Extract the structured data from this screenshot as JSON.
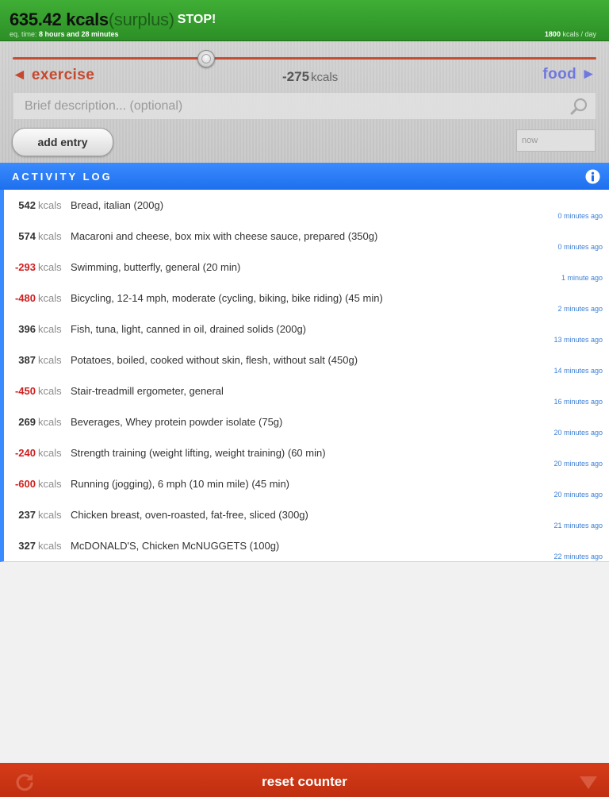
{
  "header": {
    "value": "635.42 kcals",
    "status_word": "(surplus)",
    "alert": "STOP!",
    "eq_time_label": "eq. time:",
    "eq_time_value": "8 hours and 28 minutes",
    "daily_value": "1800",
    "daily_unit": "kcals / day"
  },
  "entry": {
    "slider_level_percent": 33,
    "exercise_label": "◄ exercise",
    "food_label": "food ►",
    "amount": "-275",
    "amount_unit": "kcals",
    "description_placeholder": "Brief description... (optional)",
    "add_button": "add entry",
    "time_placeholder": "now"
  },
  "log": {
    "title": "ACTIVITY LOG",
    "unit": "kcals",
    "rows": [
      {
        "kcal": "542",
        "negative": false,
        "desc": "Bread, italian (200g)",
        "time": "0 minutes ago"
      },
      {
        "kcal": "574",
        "negative": false,
        "desc": "Macaroni and cheese, box mix with cheese sauce, prepared (350g)",
        "time": "0 minutes ago"
      },
      {
        "kcal": "-293",
        "negative": true,
        "desc": "Swimming, butterfly, general (20 min)",
        "time": "1 minute ago"
      },
      {
        "kcal": "-480",
        "negative": true,
        "desc": "Bicycling, 12-14 mph, moderate (cycling, biking, bike riding) (45 min)",
        "time": "2 minutes ago"
      },
      {
        "kcal": "396",
        "negative": false,
        "desc": "Fish, tuna, light, canned in oil, drained solids (200g)",
        "time": "13 minutes ago"
      },
      {
        "kcal": "387",
        "negative": false,
        "desc": "Potatoes, boiled, cooked without skin, flesh, without salt (450g)",
        "time": "14 minutes ago"
      },
      {
        "kcal": "-450",
        "negative": true,
        "desc": "Stair-treadmill ergometer, general",
        "time": "16 minutes ago"
      },
      {
        "kcal": "269",
        "negative": false,
        "desc": "Beverages, Whey protein powder isolate (75g)",
        "time": "20 minutes ago"
      },
      {
        "kcal": "-240",
        "negative": true,
        "desc": "Strength training (weight lifting, weight training) (60 min)",
        "time": "20 minutes ago"
      },
      {
        "kcal": "-600",
        "negative": true,
        "desc": "Running (jogging), 6 mph (10 min mile) (45 min)",
        "time": "20 minutes ago"
      },
      {
        "kcal": "237",
        "negative": false,
        "desc": "Chicken breast, oven-roasted, fat-free, sliced (300g)",
        "time": "21 minutes ago"
      },
      {
        "kcal": "327",
        "negative": false,
        "desc": "McDONALD'S, Chicken McNUGGETS (100g)",
        "time": "22 minutes ago"
      }
    ]
  },
  "footer": {
    "reset_label": "reset counter"
  },
  "colors": {
    "header_green": "#3fae35",
    "exercise_red": "#c6482d",
    "food_blue": "#6f78e0",
    "log_blue": "#3a8bff",
    "negative_red": "#d01f1f",
    "footer_red": "#d63b18"
  },
  "icons": {
    "search": "search-icon",
    "info": "info-icon",
    "refresh": "refresh-icon",
    "collapse": "collapse-icon"
  }
}
